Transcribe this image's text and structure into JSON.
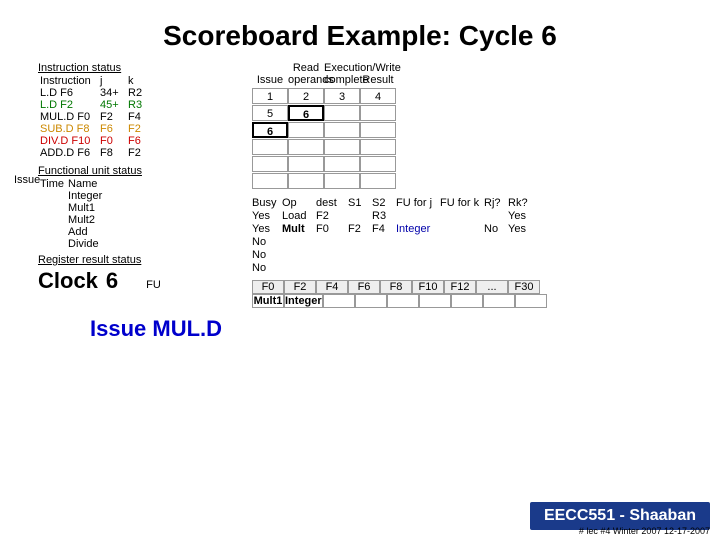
{
  "title": "Scoreboard Example:  Cycle 6",
  "issueSideLabel": "Issue",
  "issueMULD": "Issue MUL.D",
  "instrStatus": {
    "header": "Instruction status",
    "cols": [
      "Instruction",
      "j",
      "k"
    ],
    "rows": [
      {
        "instr": "L.D",
        "reg": "F6",
        "j": "34+",
        "k": "R2",
        "color": "black"
      },
      {
        "instr": "L.D",
        "reg": "F2",
        "j": "45+",
        "k": "R3",
        "color": "green"
      },
      {
        "instr": "MUL.D",
        "reg": "F0",
        "j": "F2",
        "k": "F4",
        "color": "black"
      },
      {
        "instr": "SUB.D",
        "reg": "F8",
        "j": "F6",
        "k": "F2",
        "color": "yellow"
      },
      {
        "instr": "DIV.D",
        "reg": "F10",
        "j": "F0",
        "k": "F6",
        "color": "red"
      },
      {
        "instr": "ADD.D",
        "reg": "F6",
        "j": "F8",
        "k": "F2",
        "color": "black"
      }
    ]
  },
  "funcStatus": {
    "header": "Functional unit status",
    "cols": [
      "Time",
      "Name"
    ],
    "rows": [
      {
        "time": "",
        "name": "Integer"
      },
      {
        "time": "",
        "name": "Mult1"
      },
      {
        "time": "",
        "name": "Mult2"
      },
      {
        "time": "",
        "name": "Add"
      },
      {
        "time": "",
        "name": "Divide"
      }
    ]
  },
  "regStatus": {
    "header": "Register result status"
  },
  "clock": {
    "label": "Clock",
    "value": "6",
    "fuLabel": "FU"
  },
  "scoreBoard": {
    "topLabels": [
      "Read",
      "Execution/Write",
      ""
    ],
    "subLabels": [
      "Issue",
      "operands",
      "complete",
      "Result"
    ],
    "rows": [
      {
        "cells": [
          "1",
          "2",
          "3",
          "4"
        ],
        "highlight": []
      },
      {
        "cells": [
          "5",
          "6",
          "",
          ""
        ],
        "highlight": [
          1
        ]
      },
      {
        "cells": [
          "6",
          "",
          "",
          ""
        ],
        "highlight": [
          0
        ]
      },
      {
        "cells": [
          "",
          "",
          "",
          ""
        ],
        "highlight": []
      },
      {
        "cells": [
          "",
          "",
          "",
          ""
        ],
        "highlight": []
      },
      {
        "cells": [
          "",
          "",
          "",
          ""
        ],
        "highlight": []
      }
    ]
  },
  "funcTable": {
    "cols": [
      "Busy",
      "Op",
      "dest",
      "S1",
      "S2",
      "FU for j",
      "FU for k",
      "Rj?",
      "Rk?"
    ],
    "rows": [
      {
        "busy": "Yes",
        "op": "Load",
        "dest": "F2",
        "s1": "",
        "s2": "R3",
        "fuj": "",
        "fuk": "",
        "rj": "",
        "rk": "Yes",
        "boldOp": false
      },
      {
        "busy": "Yes",
        "op": "Mult",
        "dest": "F0",
        "s1": "F2",
        "s2": "F4",
        "fuj": "Integer",
        "fuk": "",
        "rj": "No",
        "rk": "Yes",
        "boldOp": true
      },
      {
        "busy": "No",
        "op": "",
        "dest": "",
        "s1": "",
        "s2": "",
        "fuj": "",
        "fuk": "",
        "rj": "",
        "rk": ""
      },
      {
        "busy": "No",
        "op": "",
        "dest": "",
        "s1": "",
        "s2": "",
        "fuj": "",
        "fuk": "",
        "rj": "",
        "rk": ""
      },
      {
        "busy": "No",
        "op": "",
        "dest": "",
        "s1": "",
        "s2": "",
        "fuj": "",
        "fuk": "",
        "rj": "",
        "rk": ""
      }
    ]
  },
  "regTable": {
    "regs": [
      "F0",
      "F2",
      "F4",
      "F6",
      "F8",
      "F10",
      "F12",
      "...",
      "F30"
    ],
    "vals": [
      "Mult1",
      "Integer",
      "",
      "",
      "",
      "",
      "",
      "",
      ""
    ]
  },
  "footer": {
    "title": "EECC551 ",
    "strike": "- ",
    "rest": "Shaaban",
    "sub": "# lec #4  Winter 2007   12-17-2007"
  }
}
